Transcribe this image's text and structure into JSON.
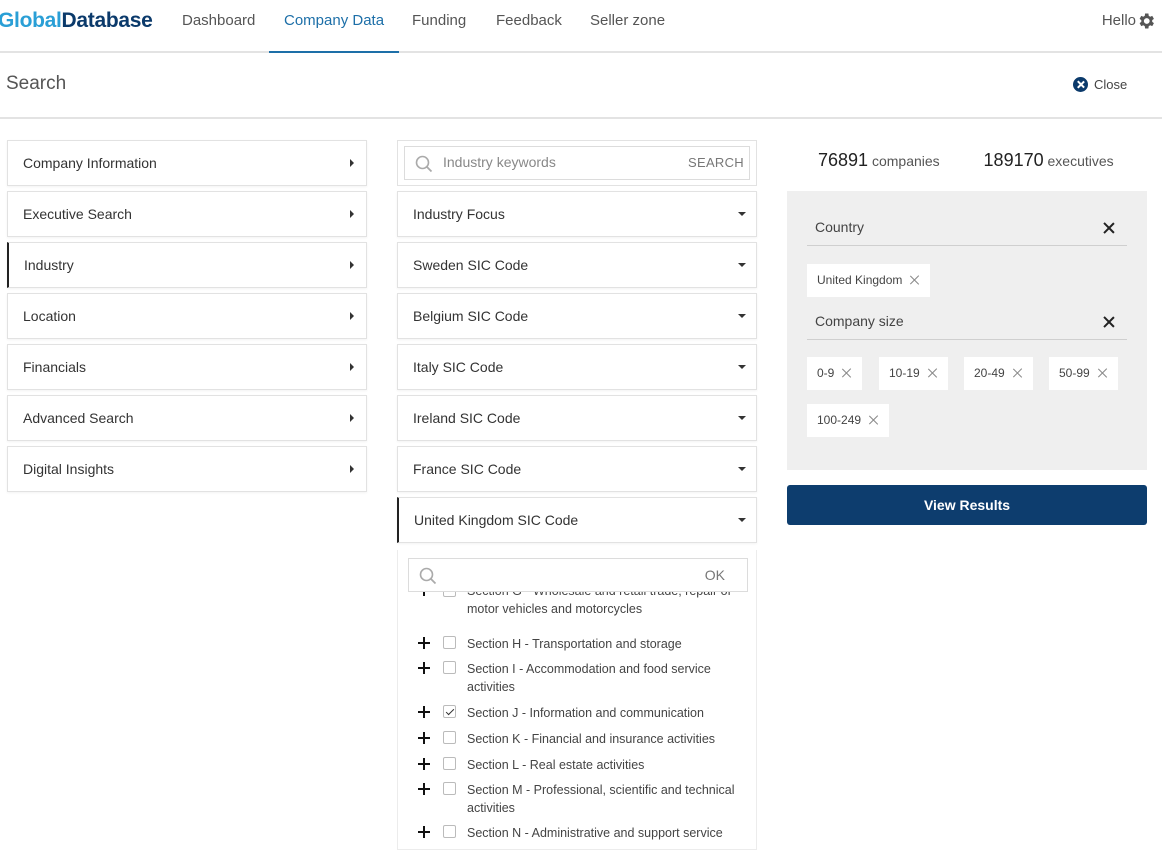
{
  "brand": {
    "part1": "Global",
    "part2": "Database"
  },
  "nav": {
    "items": [
      {
        "label": "Dashboard"
      },
      {
        "label": "Company Data"
      },
      {
        "label": "Funding"
      },
      {
        "label": "Feedback"
      },
      {
        "label": "Seller zone"
      }
    ],
    "active": "Company Data",
    "greeting": "Hello",
    "settings_icon": "gear-icon"
  },
  "search_header": {
    "title": "Search",
    "close_label": "Close",
    "close_icon": "close-circle-icon"
  },
  "left_menu": {
    "items": [
      {
        "label": "Company Information"
      },
      {
        "label": "Executive Search"
      },
      {
        "label": "Industry"
      },
      {
        "label": "Location"
      },
      {
        "label": "Financials"
      },
      {
        "label": "Advanced Search"
      },
      {
        "label": "Digital Insights"
      }
    ],
    "active": "Industry"
  },
  "industry": {
    "keyword_placeholder": "Industry keywords",
    "keyword_button": "SEARCH",
    "dropdowns": [
      {
        "label": "Industry Focus"
      },
      {
        "label": "Sweden SIC Code"
      },
      {
        "label": "Belgium SIC Code"
      },
      {
        "label": "Italy SIC Code"
      },
      {
        "label": "Ireland SIC Code"
      },
      {
        "label": "France SIC Code"
      },
      {
        "label": "United Kingdom SIC Code"
      }
    ],
    "expanded": "United Kingdom SIC Code",
    "sic_search_button": "OK",
    "sic_items": [
      {
        "label": "Section G - Wholesale and retail trade; repair of motor vehicles and motorcycles",
        "checked": false
      },
      {
        "label": "Section H - Transportation and storage",
        "checked": false
      },
      {
        "label": "Section I - Accommodation and food service activities",
        "checked": false
      },
      {
        "label": "Section J - Information and communication",
        "checked": true
      },
      {
        "label": "Section K - Financial and insurance activities",
        "checked": false
      },
      {
        "label": "Section L - Real estate activities",
        "checked": false
      },
      {
        "label": "Section M - Professional, scientific and technical activities",
        "checked": false
      },
      {
        "label": "Section N - Administrative and support service",
        "checked": false
      }
    ]
  },
  "results": {
    "companies_count": "76891",
    "companies_label": "companies",
    "executives_count": "189170",
    "executives_label": "executives",
    "filters": [
      {
        "label": "Country",
        "tags": [
          "United Kingdom"
        ]
      },
      {
        "label": "Company size",
        "tags": [
          "0-9",
          "10-19",
          "20-49",
          "50-99",
          "100-249"
        ]
      }
    ],
    "view_button": "View Results"
  },
  "colors": {
    "brand_light": "#2a9fd6",
    "brand_dark": "#0b3a6b",
    "nav_active": "#1d6fa8",
    "primary_button": "#0d3d6e"
  }
}
